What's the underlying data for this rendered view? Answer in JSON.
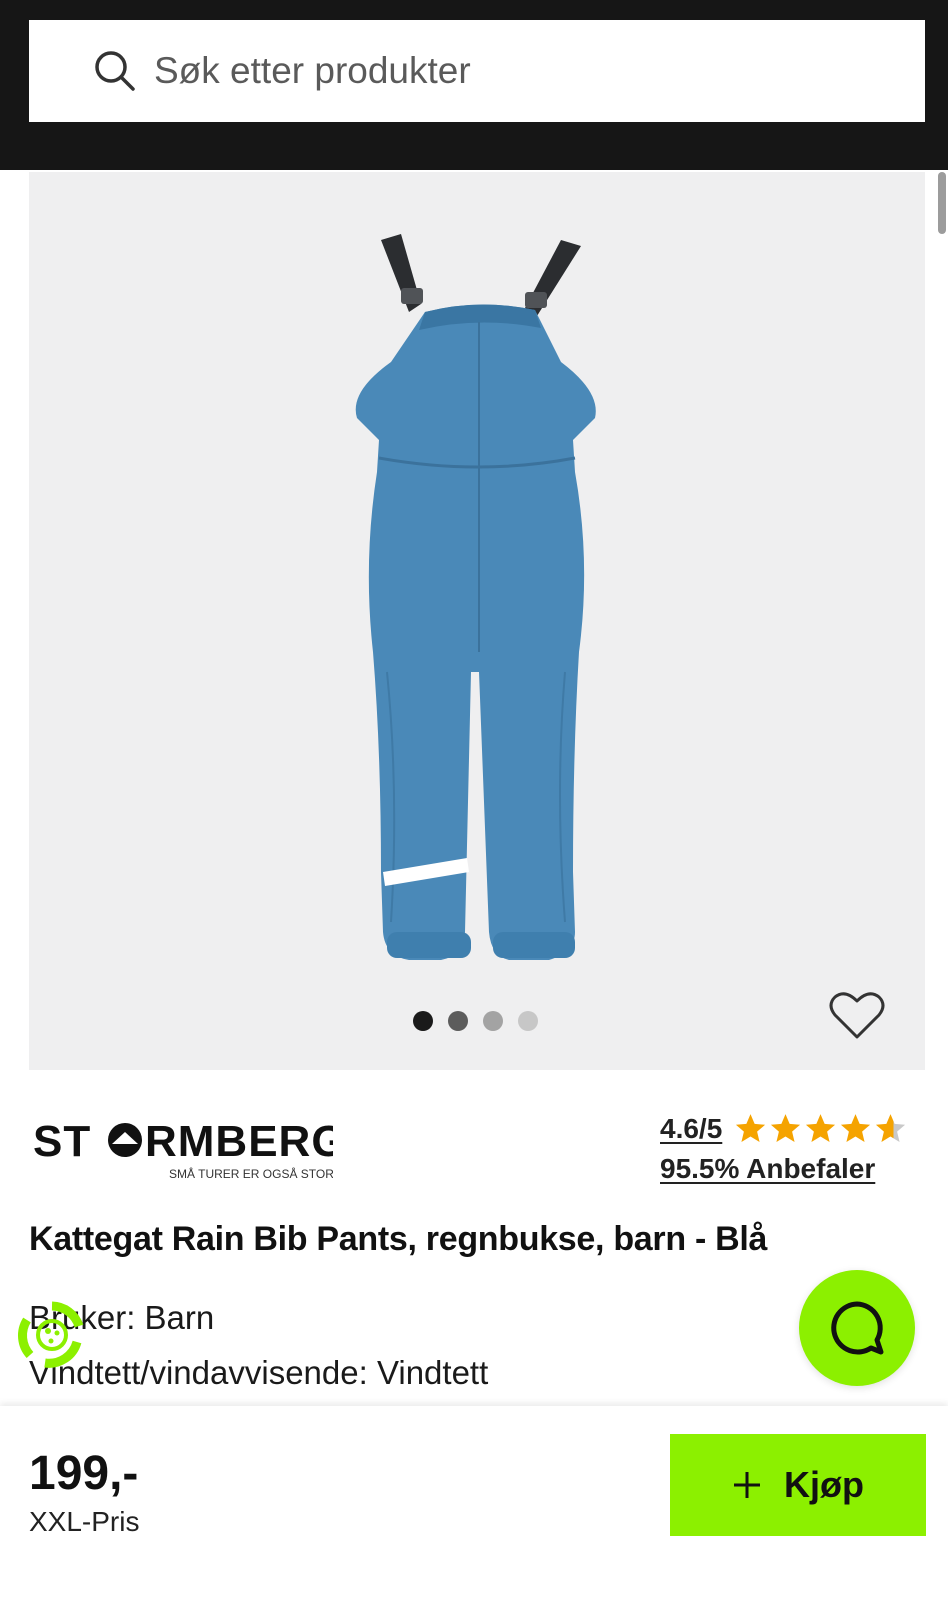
{
  "search": {
    "placeholder": "Søk etter produkter"
  },
  "gallery": {
    "slide_count": 4,
    "active_index": 0,
    "image_subject": "blue-rain-bib-pants"
  },
  "brand": {
    "name": "STORMBERG",
    "tagline": "SMÅ TURER ER OGSÅ STORE"
  },
  "rating": {
    "score": "4.6/5",
    "stars_value": 4.6,
    "recommend": "95.5% Anbefaler"
  },
  "product": {
    "title": "Kattegat Rain Bib Pants, regnbukse, barn - Blå",
    "specs": [
      "Bruker: Barn",
      "Vindtett/vindavvisende: Vindtett"
    ]
  },
  "purchase": {
    "price": "199,-",
    "price_label": "XXL-Pris",
    "buy_label": "Kjøp"
  },
  "colors": {
    "header_bg": "#161616",
    "accent": "#8cf000",
    "star": "#f5a300",
    "gallery_bg": "#efeff0"
  },
  "icons": [
    "search-icon",
    "heart-icon",
    "star-icon",
    "chat-icon",
    "eco-icon",
    "plus-icon"
  ]
}
